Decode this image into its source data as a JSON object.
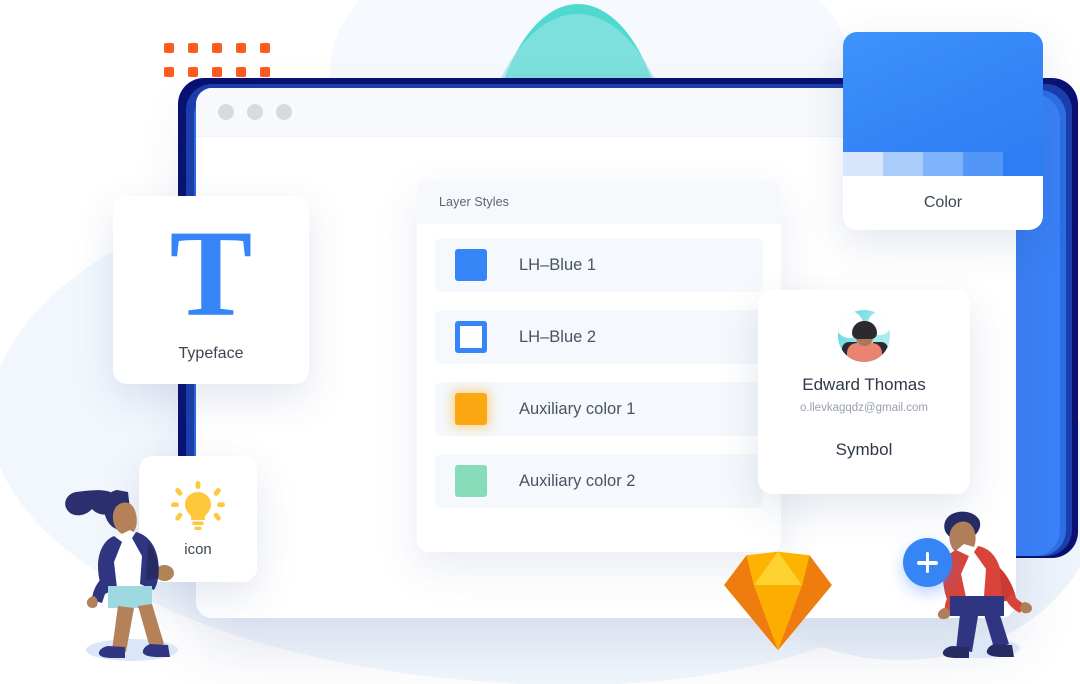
{
  "window": {
    "traffic_lights": [
      "close",
      "minimize",
      "maximize"
    ]
  },
  "panel": {
    "title": "Layer Styles",
    "rows": [
      {
        "label": "LH–Blue 1",
        "color": "#3585F7",
        "style": "filled"
      },
      {
        "label": "LH–Blue 2",
        "color": "#3585F7",
        "style": "outline"
      },
      {
        "label": "Auxiliary color 1",
        "color": "#FCA813",
        "style": "filled-glow"
      },
      {
        "label": "Auxiliary color 2",
        "color": "#87DCB9",
        "style": "filled"
      }
    ]
  },
  "typeface_card": {
    "glyph": "T",
    "caption": "Typeface",
    "color": "#3585F7"
  },
  "icon_card": {
    "caption": "icon",
    "icon": "lightbulb-icon",
    "color": "#FDC83C"
  },
  "color_card": {
    "caption": "Color",
    "main_color": "#3585F7",
    "swatches": [
      "#D7E6FC",
      "#AACCFB",
      "#7EB2FA",
      "#5297F8",
      "#2F7DF4"
    ]
  },
  "symbol_card": {
    "avatar": "user-avatar",
    "name": "Edward Thomas",
    "email": "o.llevkagqdz@gmail.com",
    "caption": "Symbol"
  },
  "decor": {
    "dot_grid_color": "#FF5B1F",
    "dot_grid_cols": 5,
    "dot_grid_rows": 2,
    "sketch_logo": "sketch-diamond-icon",
    "plus_button": "add-button",
    "person_left": "walking-woman-illustration",
    "person_right": "walking-man-illustration"
  }
}
